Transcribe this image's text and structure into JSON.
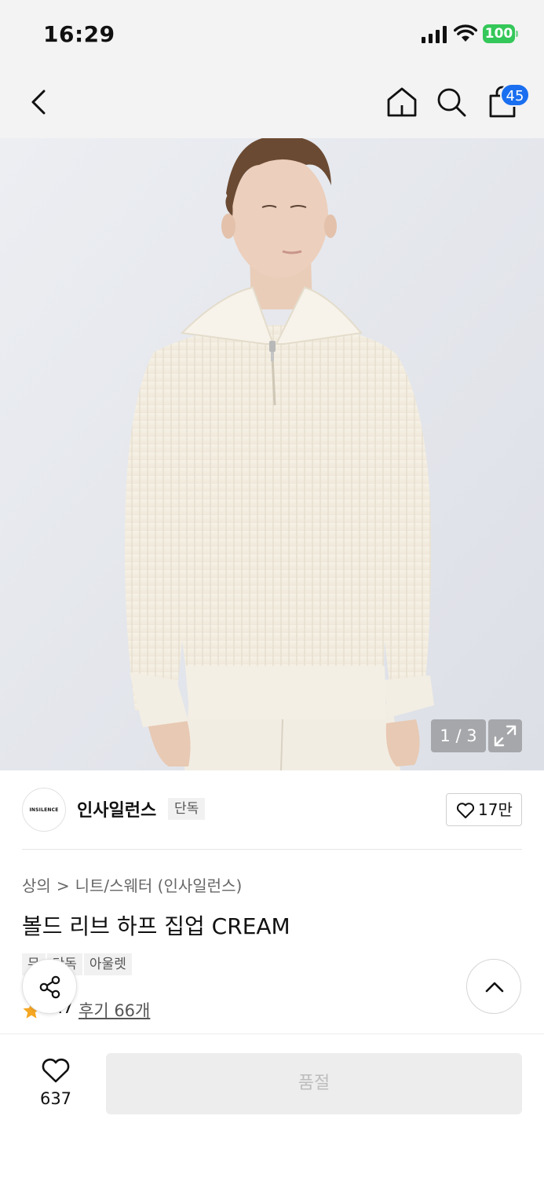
{
  "status_bar": {
    "time": "16:29",
    "battery": "100",
    "icons": [
      "cellular-signal-icon",
      "wifi-icon",
      "battery-icon"
    ]
  },
  "nav": {
    "icons": [
      "back-chevron-icon",
      "home-icon",
      "search-icon",
      "shopping-bag-icon"
    ],
    "cart_count": "45"
  },
  "gallery": {
    "pager": "1 / 3",
    "current_page": 1,
    "total_pages": 3,
    "expand_icon": "expand-icon"
  },
  "brand": {
    "logo_text": "INSILENCE",
    "name": "인사일런스",
    "exclusive_label": "단독",
    "follow_count": "17만"
  },
  "product": {
    "breadcrumb": [
      "상의",
      "니트/스웨터 (인사일런스)"
    ],
    "title": "볼드 리브 하프 집업 CREAM",
    "tags": [
      "무",
      "단독",
      "아울렛"
    ],
    "rating": "4.7",
    "reviews_link": "후기 66개"
  },
  "bottom_bar": {
    "like_count": "637",
    "buy_label": "품절"
  },
  "colors": {
    "accent_blue": "#1a6ff0",
    "battery_green": "#34c759",
    "star": "#f5a623",
    "disabled_button": "#ededed"
  }
}
